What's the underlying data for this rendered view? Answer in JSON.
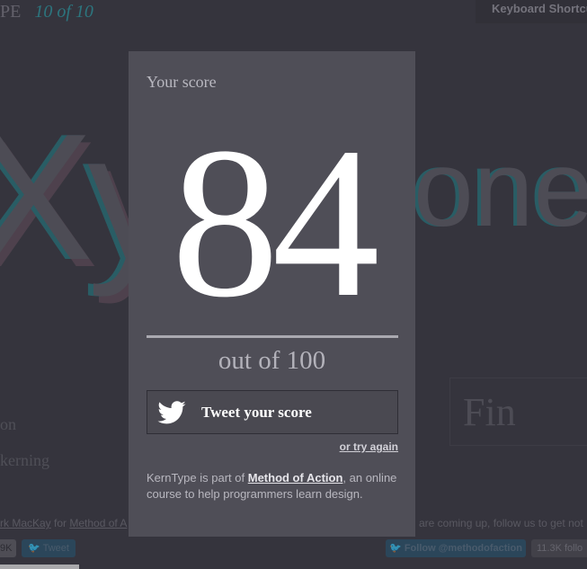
{
  "header": {
    "brand": "PE",
    "progress": "10 of 10",
    "keyboard_btn": "Keyboard Shortcuts"
  },
  "background": {
    "word_left": "Xyl",
    "word_right": "one",
    "side_1": "on",
    "side_2": "kerning",
    "fin_btn": "Fin",
    "credit_author": "rk MacKay",
    "credit_for": " for ",
    "credit_link": "Method of A",
    "credit_right": " are coming up, follow us to get not",
    "tweet_count": "9K",
    "tweet_small": "Tweet",
    "follow_btn": "Follow @methodofaction",
    "followers": "11.3K follo"
  },
  "modal": {
    "label": "Your score",
    "score": "84",
    "out_of": "out of 100",
    "tweet_label": "Tweet your score",
    "try_again": "or try again",
    "about_pre": "KernType is part of ",
    "about_link": "Method of Action",
    "about_post": ", an online course to help programmers learn design."
  },
  "colors": {
    "accent": "#2e8f99",
    "modal_bg": "#4f4e57",
    "page_bg": "#3a3942"
  }
}
